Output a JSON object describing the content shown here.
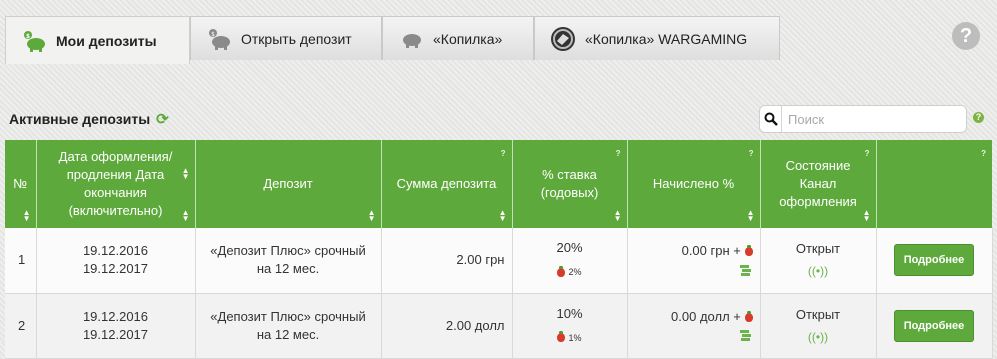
{
  "tabs": [
    {
      "label": "Мои депозиты",
      "icon": "piggy-bank-icon",
      "active": true
    },
    {
      "label": "Открыть депозит",
      "icon": "piggy-bank-coins-icon",
      "active": false
    },
    {
      "label": "«Копилка»",
      "icon": "piggy-bank-icon",
      "active": false
    },
    {
      "label": "«Копилка» WARGAMING",
      "icon": "wargaming-logo-icon",
      "active": false
    }
  ],
  "help_icon": "?",
  "section_title": "Активные депозиты",
  "search": {
    "placeholder": "Поиск"
  },
  "table": {
    "headers": {
      "num": "№",
      "date": "Дата оформления/ продления Дата окончания (включительно)",
      "deposit": "Депозит",
      "amount": "Сумма депозита",
      "rate": "% ставка (годовых)",
      "accrued": "Начислено %",
      "status": "Состояние Канал оформления",
      "help_mark": "?"
    },
    "rows": [
      {
        "num": "1",
        "date_open": "19.12.2016",
        "date_end": "19.12.2017",
        "deposit": "«Депозит Плюс» срочный на 12 мес.",
        "amount": "2.00 грн",
        "rate": "20%",
        "bonus_rate": "2%",
        "accrued": "0.00 грн +",
        "status": "Открыт",
        "button": "Подробнее"
      },
      {
        "num": "2",
        "date_open": "19.12.2016",
        "date_end": "19.12.2017",
        "deposit": "«Депозит Плюс» срочный на 12 мес.",
        "amount": "2.00 долл",
        "rate": "10%",
        "bonus_rate": "1%",
        "accrued": "0.00 долл +",
        "status": "Открыт",
        "button": "Подробнее"
      }
    ]
  },
  "colors": {
    "header_green": "#5ea93c",
    "accent_green": "#7cb342",
    "berry_red": "#d93a2b"
  }
}
